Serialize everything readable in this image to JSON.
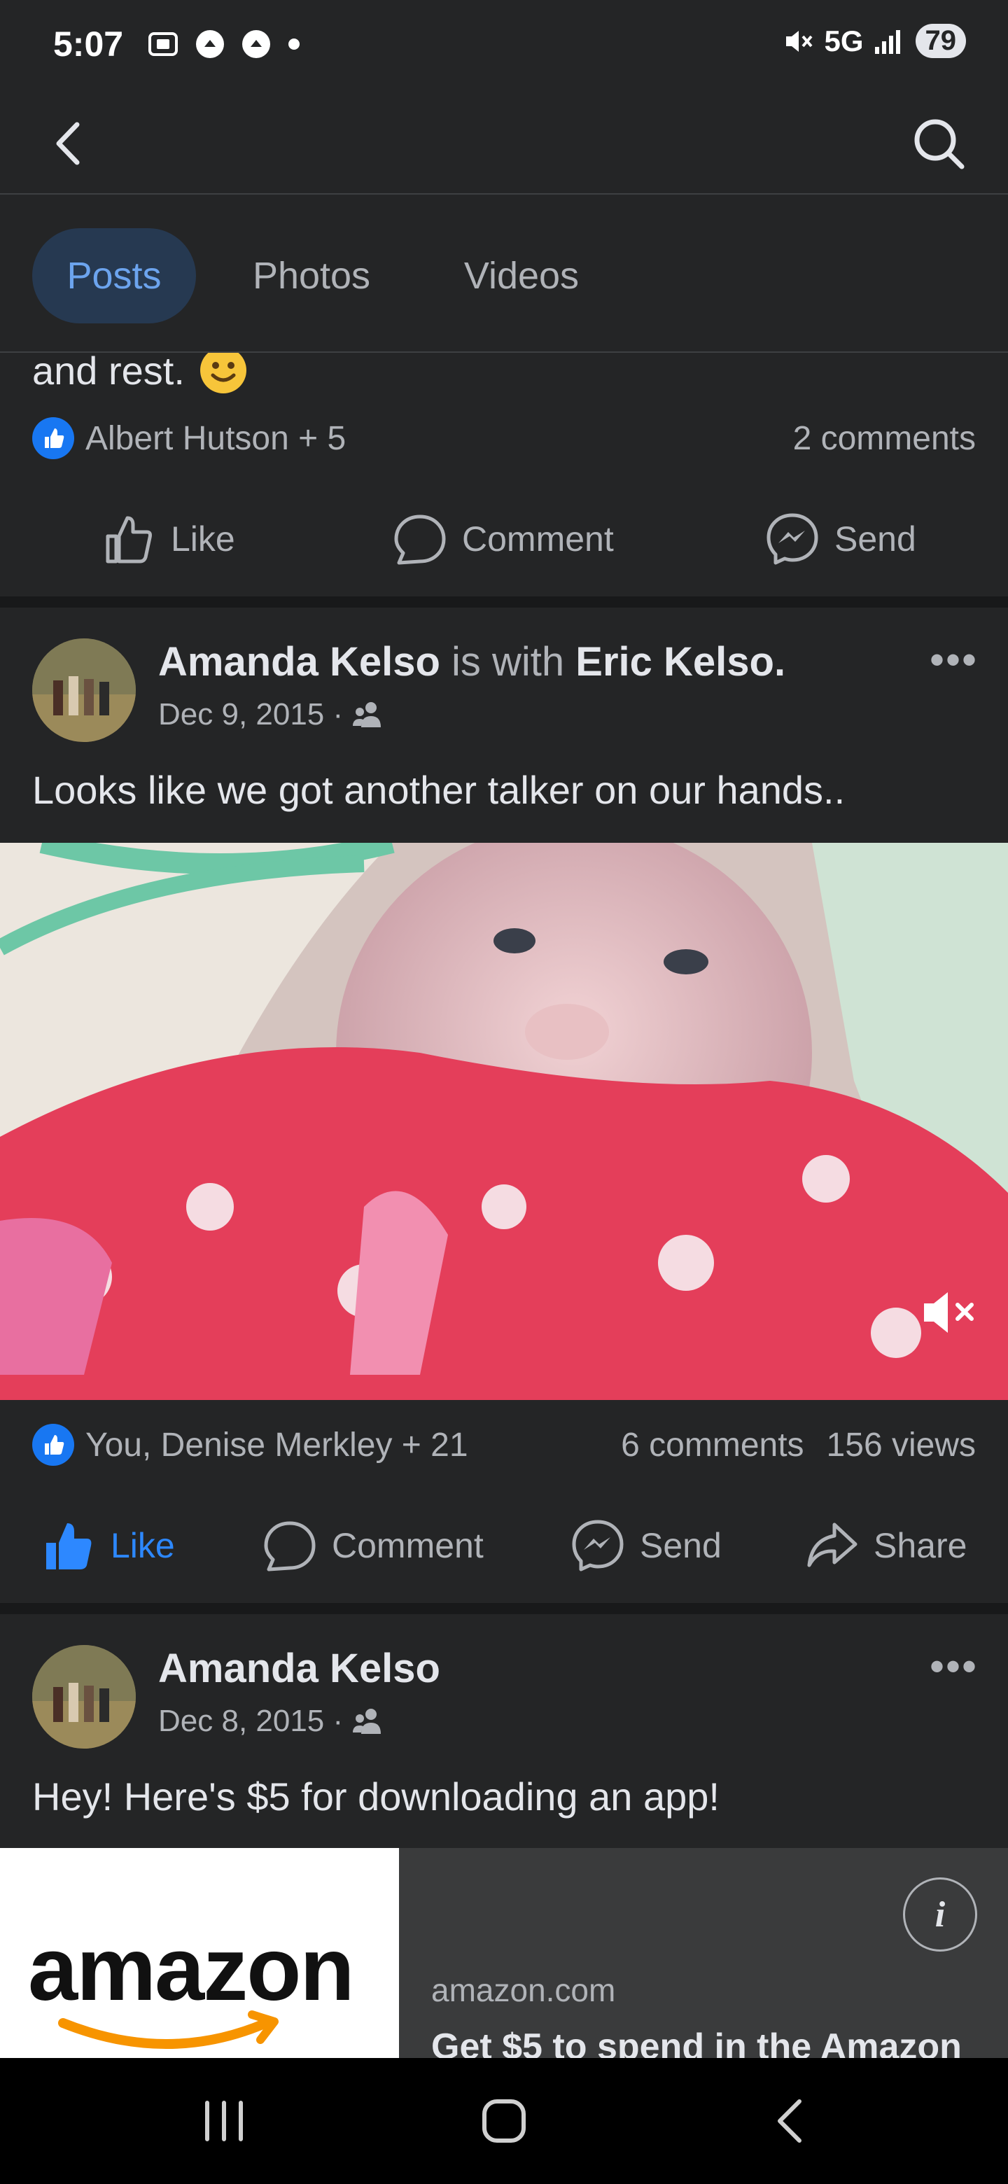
{
  "status_bar": {
    "time": "5:07",
    "network": "5G",
    "battery": "79"
  },
  "tabs": [
    {
      "label": "Posts",
      "active": true
    },
    {
      "label": "Photos",
      "active": false
    },
    {
      "label": "Videos",
      "active": false
    }
  ],
  "post1": {
    "text_tail": "and rest.",
    "reactions": "Albert Hutson + 5",
    "comments": "2 comments",
    "actions": {
      "like": "Like",
      "comment": "Comment",
      "send": "Send"
    }
  },
  "post2": {
    "author": "Amanda Kelso",
    "with_text": "is with",
    "tagged": "Eric Kelso",
    "date": "Dec 9, 2015 ·",
    "text": "Looks like we got another talker on our hands..",
    "reactions": "You, Denise Merkley + 21",
    "comments": "6 comments",
    "views": "156 views",
    "actions": {
      "like": "Like",
      "comment": "Comment",
      "send": "Send",
      "share": "Share"
    }
  },
  "post3": {
    "author": "Amanda Kelso",
    "date": "Dec 8, 2015 ·",
    "text": "Hey! Here's $5 for downloading an app!",
    "ad": {
      "logo_text": "amazon",
      "domain": "amazon.com",
      "headline": "Get $5 to spend in the Amazon"
    }
  },
  "colors": {
    "background": "#242526",
    "accent": "#1877f2",
    "active_tab_bg": "#263951",
    "active_tab_text": "#6ca4ee"
  }
}
